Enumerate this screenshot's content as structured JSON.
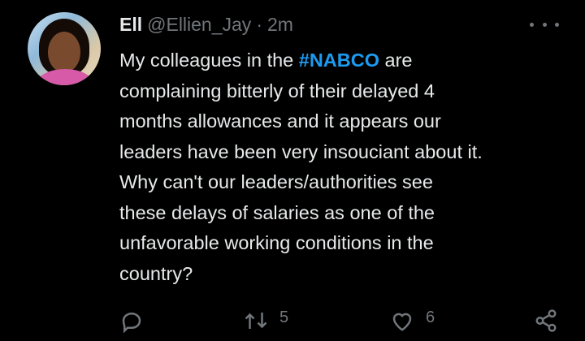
{
  "tweet": {
    "author_name": "Ell",
    "author_handle": "@Ellien_Jay",
    "separator": "·",
    "time": "2m",
    "text_lines": [
      {
        "before": "My colleagues in the ",
        "hashtag": "#NABCO",
        "after": " are"
      },
      {
        "before": "complaining bitterly of their delayed 4"
      },
      {
        "before": "months allowances and it appears our"
      },
      {
        "before": "leaders have been very insouciant about it."
      },
      {
        "before": "Why can't our leaders/authorities see"
      },
      {
        "before": "these delays of salaries as one of the"
      },
      {
        "before": "unfavorable working conditions in the"
      },
      {
        "before": "country?"
      }
    ],
    "retweet_count": "5",
    "like_count": "6"
  },
  "icons": {
    "more": "more-options-icon",
    "reply": "reply-icon",
    "retweet": "retweet-icon",
    "like": "like-icon",
    "share": "share-icon"
  },
  "colors": {
    "background": "#000000",
    "text": "#e7e9ea",
    "muted": "#71767b",
    "accent": "#1d9bf0"
  }
}
